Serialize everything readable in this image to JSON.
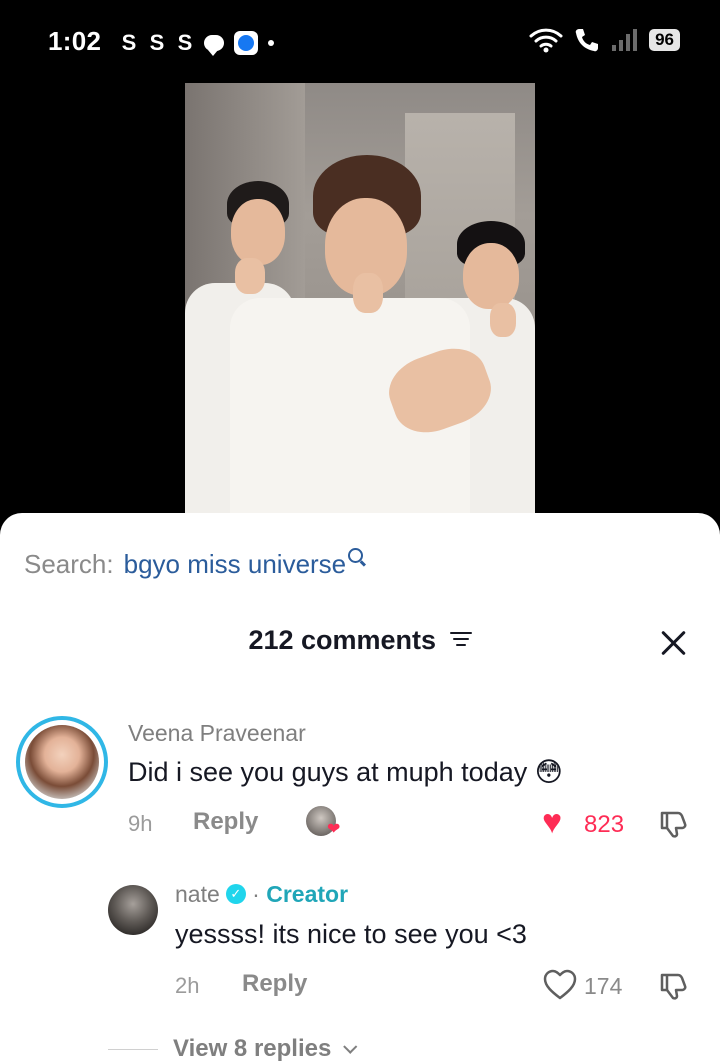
{
  "status_bar": {
    "time": "1:02",
    "notif_s": [
      "S",
      "S",
      "S"
    ],
    "battery": "96"
  },
  "sheet": {
    "search_label": "Search:",
    "search_term": "bgyo miss universe",
    "comments_header": "212 comments"
  },
  "comments": [
    {
      "username": "Veena Praveenar",
      "text": "Did i see you guys at muph today 😳",
      "time": "9h",
      "reply_label": "Reply",
      "likes": "823",
      "liked": true
    }
  ],
  "reply": {
    "username": "nate",
    "badge": "Creator",
    "text": "yessss! its nice to see you <3",
    "time": "2h",
    "reply_label": "Reply",
    "likes": "174"
  },
  "view_replies": "View 8 replies",
  "colors": {
    "accent_red": "#fe2c55",
    "link_blue": "#2b5c9b",
    "creator_teal": "#20a6b8",
    "ring_blue": "#30b7e6"
  }
}
